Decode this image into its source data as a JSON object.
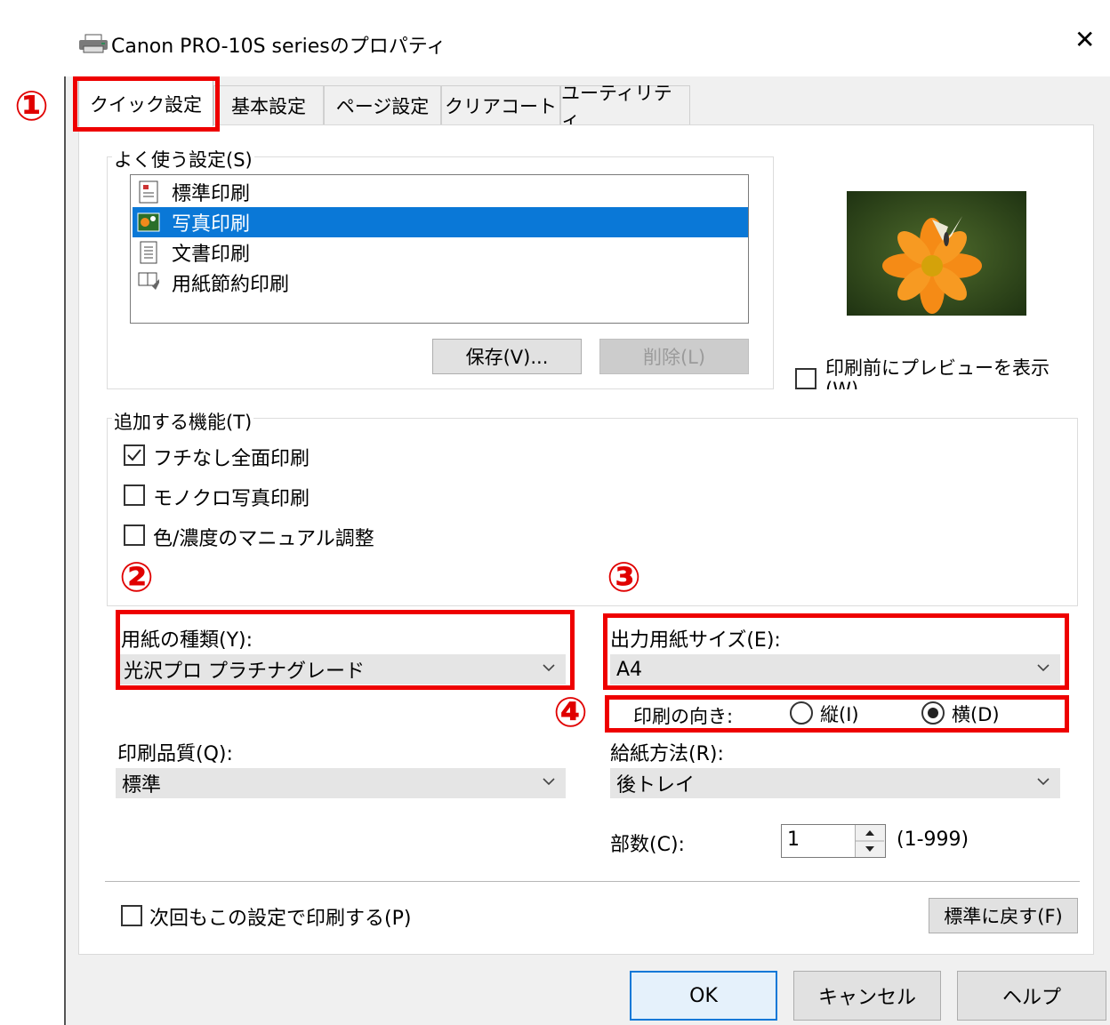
{
  "window": {
    "title": "Canon PRO-10S seriesのプロパティ",
    "close_glyph": "✕"
  },
  "annotations": [
    "①",
    "②",
    "③",
    "④"
  ],
  "tabs": [
    {
      "label": "クイック設定",
      "active": true
    },
    {
      "label": "基本設定",
      "active": false
    },
    {
      "label": "ページ設定",
      "active": false
    },
    {
      "label": "クリアコート",
      "active": false
    },
    {
      "label": "ユーティリティ",
      "active": false
    }
  ],
  "favorites": {
    "label": "よく使う設定(S)",
    "items": [
      {
        "label": "標準印刷",
        "icon": "standard-print-icon",
        "selected": false
      },
      {
        "label": "写真印刷",
        "icon": "photo-print-icon",
        "selected": true
      },
      {
        "label": "文書印刷",
        "icon": "document-print-icon",
        "selected": false
      },
      {
        "label": "用紙節約印刷",
        "icon": "paper-saving-icon",
        "selected": false
      }
    ],
    "save_button": "保存(V)...",
    "delete_button": "削除(L)"
  },
  "preview": {
    "checkbox_label_line1": "印刷前にプレビューを表示",
    "checkbox_label_line2": "(W)",
    "checked": false
  },
  "additional": {
    "label": "追加する機能(T)",
    "options": [
      {
        "label": "フチなし全面印刷",
        "checked": true
      },
      {
        "label": "モノクロ写真印刷",
        "checked": false
      },
      {
        "label": "色/濃度のマニュアル調整",
        "checked": false
      }
    ]
  },
  "media_type": {
    "label": "用紙の種類(Y):",
    "value": "光沢プロ プラチナグレード"
  },
  "output_size": {
    "label": "出力用紙サイズ(E):",
    "value": "A4"
  },
  "orientation": {
    "label": "印刷の向き:",
    "portrait": "縦(I)",
    "landscape": "横(D)",
    "selected": "landscape"
  },
  "quality": {
    "label": "印刷品質(Q):",
    "value": "標準"
  },
  "paper_source": {
    "label": "給紙方法(R):",
    "value": "後トレイ"
  },
  "copies": {
    "label": "部数(C):",
    "value": "1",
    "range": "(1-999)"
  },
  "always_print": {
    "label": "次回もこの設定で印刷する(P)",
    "checked": false
  },
  "defaults_button": "標準に戻す(F)",
  "buttons": {
    "ok": "OK",
    "cancel": "キャンセル",
    "help": "ヘルプ"
  },
  "colors": {
    "accent": "#0a78d7",
    "annotation_red": "#ee0000"
  }
}
